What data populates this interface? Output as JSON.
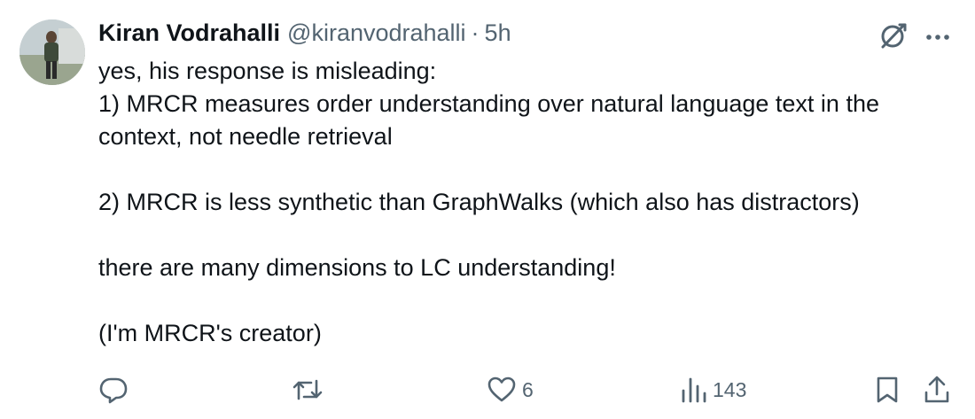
{
  "tweet": {
    "author_name": "Kiran Vodrahalli",
    "handle": "@kiranvodrahalli",
    "separator": "·",
    "time": "5h",
    "lines": [
      "yes, his response is misleading:",
      "1) MRCR measures order understanding over natural language text in the context, not needle retrieval",
      "2) MRCR is less synthetic than GraphWalks (which also has distractors)",
      "there are many dimensions to LC understanding!",
      "(I'm MRCR's creator)"
    ]
  },
  "actions": {
    "likes": "6",
    "views": "143"
  },
  "icons": {
    "top": [
      "grok-icon",
      "more-icon"
    ],
    "bottom": [
      "reply-icon",
      "retweet-icon",
      "like-icon",
      "views-icon",
      "bookmark-icon",
      "share-icon"
    ]
  },
  "colors": {
    "text": "#0f1419",
    "secondary": "#536471",
    "background": "#ffffff"
  }
}
